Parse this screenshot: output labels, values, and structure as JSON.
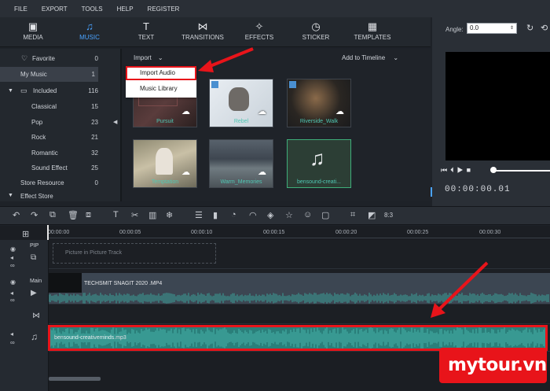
{
  "menubar": {
    "items": [
      "FILE",
      "EXPORT",
      "TOOLS",
      "HELP",
      "REGISTER"
    ]
  },
  "modules": [
    {
      "label": "MEDIA",
      "icon": "folder-icon",
      "active": false
    },
    {
      "label": "MUSIC",
      "icon": "music-note-icon",
      "active": true
    },
    {
      "label": "TEXT",
      "icon": "text-icon",
      "active": false
    },
    {
      "label": "TRANSITIONS",
      "icon": "bowtie-icon",
      "active": false
    },
    {
      "label": "EFFECTS",
      "icon": "sparkle-icon",
      "active": false
    },
    {
      "label": "STICKER",
      "icon": "clock-icon",
      "active": false
    },
    {
      "label": "TEMPLATES",
      "icon": "grid-icon",
      "active": false
    }
  ],
  "library": {
    "items": [
      {
        "label": "Favorite",
        "count": "0"
      },
      {
        "label": "My Music",
        "count": "1"
      },
      {
        "label": "Included",
        "count": "116"
      },
      {
        "label": "Classical",
        "count": "15"
      },
      {
        "label": "Pop",
        "count": "23"
      },
      {
        "label": "Rock",
        "count": "21"
      },
      {
        "label": "Romantic",
        "count": "32"
      },
      {
        "label": "Sound Effect",
        "count": "25"
      },
      {
        "label": "Store Resource",
        "count": "0"
      },
      {
        "label": "Effect Store",
        "count": ""
      }
    ]
  },
  "media": {
    "import_label": "Import",
    "add_to_timeline_label": "Add to Timeline",
    "dropdown": {
      "import_audio": "Import Audio",
      "music_library": "Music Library"
    },
    "tiles": [
      {
        "caption": "Pursuit"
      },
      {
        "caption": "Rebel"
      },
      {
        "caption": "Riverside_Walk"
      },
      {
        "caption": "Temptation"
      },
      {
        "caption": "Warm_Memories"
      },
      {
        "caption": "bensound-creati..."
      }
    ]
  },
  "preview": {
    "angle_label": "Angle:",
    "angle_value": "0.0",
    "timecode": "00:00:00.01"
  },
  "toolbar": {
    "speed_label": "8:3"
  },
  "timeline": {
    "ticks": [
      "00:00:00",
      "00:00:05",
      "00:00:10",
      "00:00:15",
      "00:00:20",
      "00:00:25",
      "00:00:30"
    ],
    "pip_label": "PIP",
    "main_label": "Main",
    "pip_placeholder": "Picture in Picture Track",
    "video_clip": "TECHSMIT SNAGIT 2020 .MP4",
    "audio_clip": "bensound-creativeminds.mp3"
  },
  "watermark": {
    "text": "mytour.vn"
  },
  "colors": {
    "accent": "#4aa3ff",
    "highlight_red": "#e8141a",
    "waveform": "#2a7f7a",
    "caption_teal": "#4fc7b3"
  }
}
